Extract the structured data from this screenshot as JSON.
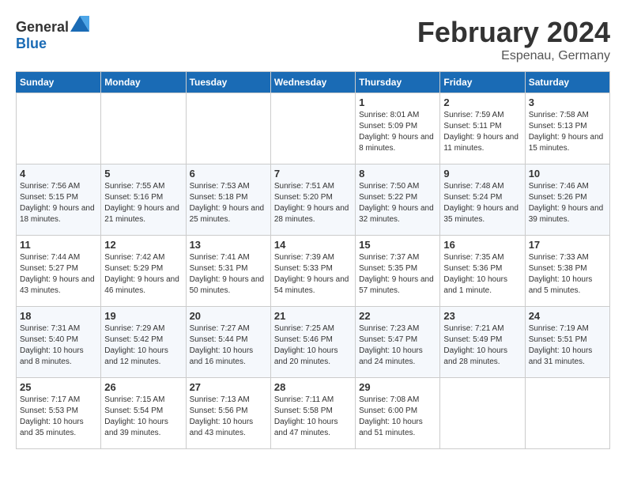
{
  "logo": {
    "text_general": "General",
    "text_blue": "Blue"
  },
  "title": {
    "month_year": "February 2024",
    "location": "Espenau, Germany"
  },
  "weekdays": [
    "Sunday",
    "Monday",
    "Tuesday",
    "Wednesday",
    "Thursday",
    "Friday",
    "Saturday"
  ],
  "weeks": [
    [
      {
        "day": "",
        "sunrise": "",
        "sunset": "",
        "daylight": ""
      },
      {
        "day": "",
        "sunrise": "",
        "sunset": "",
        "daylight": ""
      },
      {
        "day": "",
        "sunrise": "",
        "sunset": "",
        "daylight": ""
      },
      {
        "day": "",
        "sunrise": "",
        "sunset": "",
        "daylight": ""
      },
      {
        "day": "1",
        "sunrise": "Sunrise: 8:01 AM",
        "sunset": "Sunset: 5:09 PM",
        "daylight": "Daylight: 9 hours and 8 minutes."
      },
      {
        "day": "2",
        "sunrise": "Sunrise: 7:59 AM",
        "sunset": "Sunset: 5:11 PM",
        "daylight": "Daylight: 9 hours and 11 minutes."
      },
      {
        "day": "3",
        "sunrise": "Sunrise: 7:58 AM",
        "sunset": "Sunset: 5:13 PM",
        "daylight": "Daylight: 9 hours and 15 minutes."
      }
    ],
    [
      {
        "day": "4",
        "sunrise": "Sunrise: 7:56 AM",
        "sunset": "Sunset: 5:15 PM",
        "daylight": "Daylight: 9 hours and 18 minutes."
      },
      {
        "day": "5",
        "sunrise": "Sunrise: 7:55 AM",
        "sunset": "Sunset: 5:16 PM",
        "daylight": "Daylight: 9 hours and 21 minutes."
      },
      {
        "day": "6",
        "sunrise": "Sunrise: 7:53 AM",
        "sunset": "Sunset: 5:18 PM",
        "daylight": "Daylight: 9 hours and 25 minutes."
      },
      {
        "day": "7",
        "sunrise": "Sunrise: 7:51 AM",
        "sunset": "Sunset: 5:20 PM",
        "daylight": "Daylight: 9 hours and 28 minutes."
      },
      {
        "day": "8",
        "sunrise": "Sunrise: 7:50 AM",
        "sunset": "Sunset: 5:22 PM",
        "daylight": "Daylight: 9 hours and 32 minutes."
      },
      {
        "day": "9",
        "sunrise": "Sunrise: 7:48 AM",
        "sunset": "Sunset: 5:24 PM",
        "daylight": "Daylight: 9 hours and 35 minutes."
      },
      {
        "day": "10",
        "sunrise": "Sunrise: 7:46 AM",
        "sunset": "Sunset: 5:26 PM",
        "daylight": "Daylight: 9 hours and 39 minutes."
      }
    ],
    [
      {
        "day": "11",
        "sunrise": "Sunrise: 7:44 AM",
        "sunset": "Sunset: 5:27 PM",
        "daylight": "Daylight: 9 hours and 43 minutes."
      },
      {
        "day": "12",
        "sunrise": "Sunrise: 7:42 AM",
        "sunset": "Sunset: 5:29 PM",
        "daylight": "Daylight: 9 hours and 46 minutes."
      },
      {
        "day": "13",
        "sunrise": "Sunrise: 7:41 AM",
        "sunset": "Sunset: 5:31 PM",
        "daylight": "Daylight: 9 hours and 50 minutes."
      },
      {
        "day": "14",
        "sunrise": "Sunrise: 7:39 AM",
        "sunset": "Sunset: 5:33 PM",
        "daylight": "Daylight: 9 hours and 54 minutes."
      },
      {
        "day": "15",
        "sunrise": "Sunrise: 7:37 AM",
        "sunset": "Sunset: 5:35 PM",
        "daylight": "Daylight: 9 hours and 57 minutes."
      },
      {
        "day": "16",
        "sunrise": "Sunrise: 7:35 AM",
        "sunset": "Sunset: 5:36 PM",
        "daylight": "Daylight: 10 hours and 1 minute."
      },
      {
        "day": "17",
        "sunrise": "Sunrise: 7:33 AM",
        "sunset": "Sunset: 5:38 PM",
        "daylight": "Daylight: 10 hours and 5 minutes."
      }
    ],
    [
      {
        "day": "18",
        "sunrise": "Sunrise: 7:31 AM",
        "sunset": "Sunset: 5:40 PM",
        "daylight": "Daylight: 10 hours and 8 minutes."
      },
      {
        "day": "19",
        "sunrise": "Sunrise: 7:29 AM",
        "sunset": "Sunset: 5:42 PM",
        "daylight": "Daylight: 10 hours and 12 minutes."
      },
      {
        "day": "20",
        "sunrise": "Sunrise: 7:27 AM",
        "sunset": "Sunset: 5:44 PM",
        "daylight": "Daylight: 10 hours and 16 minutes."
      },
      {
        "day": "21",
        "sunrise": "Sunrise: 7:25 AM",
        "sunset": "Sunset: 5:46 PM",
        "daylight": "Daylight: 10 hours and 20 minutes."
      },
      {
        "day": "22",
        "sunrise": "Sunrise: 7:23 AM",
        "sunset": "Sunset: 5:47 PM",
        "daylight": "Daylight: 10 hours and 24 minutes."
      },
      {
        "day": "23",
        "sunrise": "Sunrise: 7:21 AM",
        "sunset": "Sunset: 5:49 PM",
        "daylight": "Daylight: 10 hours and 28 minutes."
      },
      {
        "day": "24",
        "sunrise": "Sunrise: 7:19 AM",
        "sunset": "Sunset: 5:51 PM",
        "daylight": "Daylight: 10 hours and 31 minutes."
      }
    ],
    [
      {
        "day": "25",
        "sunrise": "Sunrise: 7:17 AM",
        "sunset": "Sunset: 5:53 PM",
        "daylight": "Daylight: 10 hours and 35 minutes."
      },
      {
        "day": "26",
        "sunrise": "Sunrise: 7:15 AM",
        "sunset": "Sunset: 5:54 PM",
        "daylight": "Daylight: 10 hours and 39 minutes."
      },
      {
        "day": "27",
        "sunrise": "Sunrise: 7:13 AM",
        "sunset": "Sunset: 5:56 PM",
        "daylight": "Daylight: 10 hours and 43 minutes."
      },
      {
        "day": "28",
        "sunrise": "Sunrise: 7:11 AM",
        "sunset": "Sunset: 5:58 PM",
        "daylight": "Daylight: 10 hours and 47 minutes."
      },
      {
        "day": "29",
        "sunrise": "Sunrise: 7:08 AM",
        "sunset": "Sunset: 6:00 PM",
        "daylight": "Daylight: 10 hours and 51 minutes."
      },
      {
        "day": "",
        "sunrise": "",
        "sunset": "",
        "daylight": ""
      },
      {
        "day": "",
        "sunrise": "",
        "sunset": "",
        "daylight": ""
      }
    ]
  ]
}
